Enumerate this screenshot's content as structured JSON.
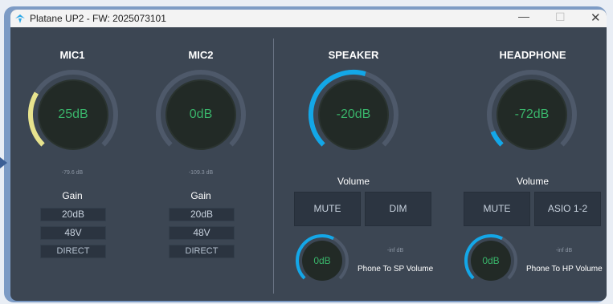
{
  "window": {
    "title": "Platane UP2 - FW: 2025073101",
    "controls": [
      "minimize",
      "maximize",
      "close"
    ],
    "close_glyph": "✕",
    "minimize_glyph": "—",
    "maximize_glyph": "☐"
  },
  "colors": {
    "background": "#3c4653",
    "knob_fill": "#222a26",
    "arc_track": "#4e596a",
    "value_text": "#39b46a",
    "mic_arc": "#e7e38e",
    "output_arc": "#13a7e8"
  },
  "inputs": [
    {
      "title": "MIC1",
      "knob_value": "25dB",
      "knob_level": 0.28,
      "meter": "-79.6 dB",
      "gain_label": "Gain",
      "gain_value": "20dB",
      "phantom": "48V",
      "direct": "DIRECT"
    },
    {
      "title": "MIC2",
      "knob_value": "0dB",
      "knob_level": 0.0,
      "meter": "-109.3 dB",
      "gain_label": "Gain",
      "gain_value": "20dB",
      "phantom": "48V",
      "direct": "DIRECT"
    }
  ],
  "outputs": [
    {
      "title": "SPEAKER",
      "knob_value": "-20dB",
      "knob_level": 0.56,
      "volume_label": "Volume",
      "button_1": "MUTE",
      "button_2": "DIM",
      "phone_knob_value": "0dB",
      "phone_level": 0.6,
      "phone_meter": "-inf dB",
      "phone_label": "Phone To SP Volume"
    },
    {
      "title": "HEADPHONE",
      "knob_value": "-72dB",
      "knob_level": 0.08,
      "volume_label": "Volume",
      "button_1": "MUTE",
      "button_2": "ASIO 1-2",
      "phone_knob_value": "0dB",
      "phone_level": 0.6,
      "phone_meter": "-inf dB",
      "phone_label": "Phone To HP Volume"
    }
  ]
}
